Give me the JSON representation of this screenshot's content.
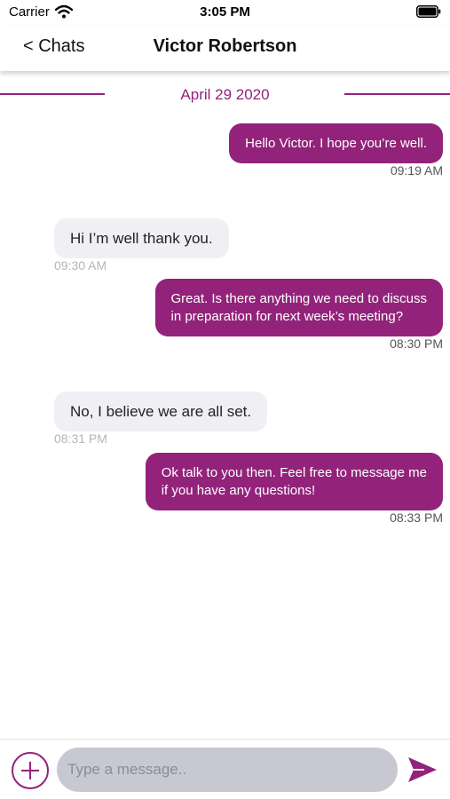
{
  "status_bar": {
    "carrier": "Carrier",
    "time": "3:05 PM",
    "icons": [
      "wifi-icon",
      "battery-icon"
    ]
  },
  "nav": {
    "back_label": "< Chats",
    "title": "Victor Robertson"
  },
  "date_divider": "April 29 2020",
  "messages": [
    {
      "direction": "outgoing",
      "lines": [
        "Hello Victor. I hope you’re well."
      ],
      "time": "09:19 AM"
    },
    {
      "direction": "incoming",
      "lines": [
        "Hi I’m well thank you."
      ],
      "time": "09:30 AM"
    },
    {
      "direction": "outgoing",
      "lines": [
        "Great. Is there anything we need to discuss",
        "in preparation for next week’s meeting?"
      ],
      "time": "08:30 PM"
    },
    {
      "direction": "incoming",
      "lines": [
        "No, I believe we are all set."
      ],
      "time": "08:31 PM"
    },
    {
      "direction": "outgoing",
      "lines": [
        "Ok talk to you then. Feel free to message me",
        "if you have any questions!"
      ],
      "time": "08:33 PM"
    }
  ],
  "composer": {
    "placeholder": "Type a message..",
    "value": "",
    "icons": [
      "plus-icon",
      "send-icon"
    ]
  },
  "colors": {
    "accent": "#93237a",
    "incoming_bubble": "#f0f0f4",
    "input_background": "#c8c8d2"
  }
}
